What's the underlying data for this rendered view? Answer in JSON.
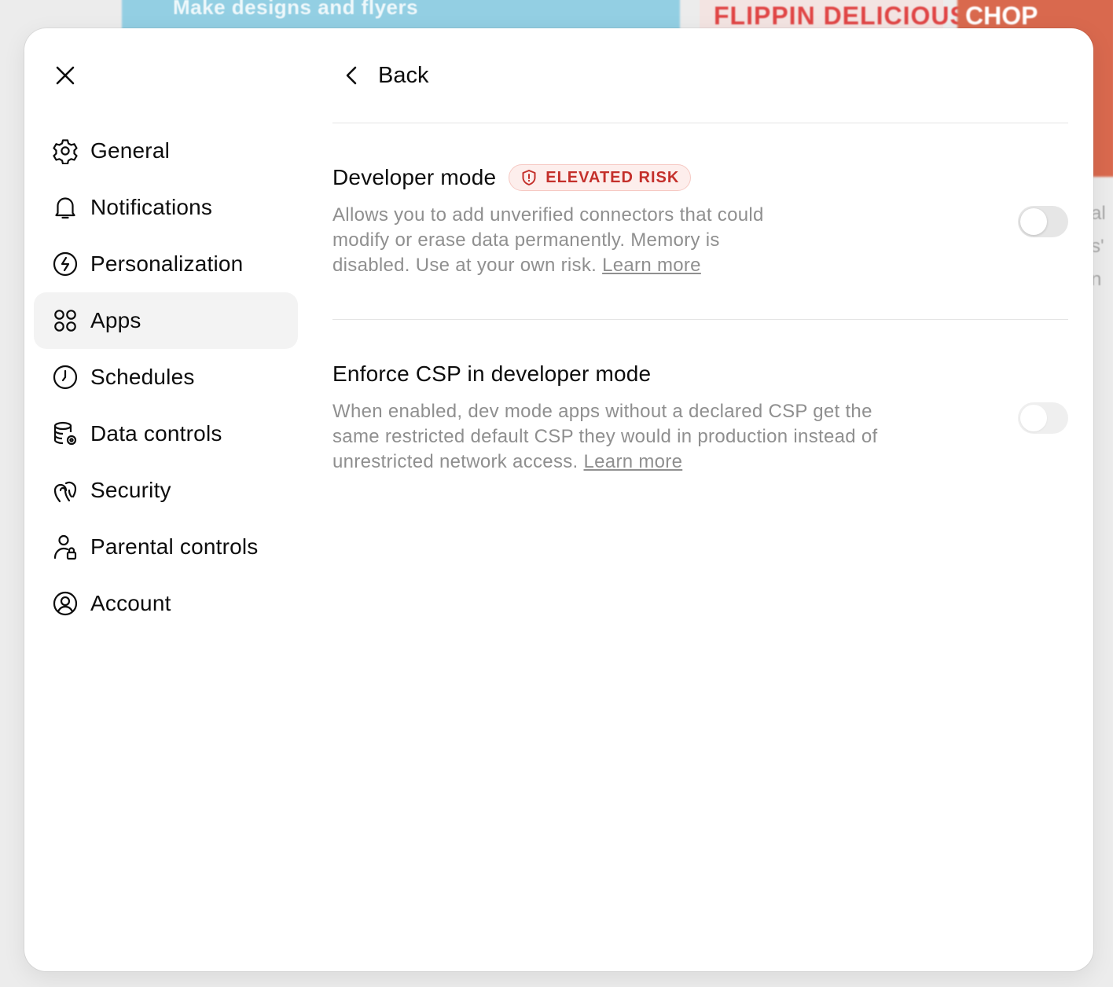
{
  "background": {
    "blue_card_text": "Make designs and flyers",
    "red_card_text": "FLIPPIN DELICIOUS",
    "red_card2_text": "CHOP",
    "side_fragments": [
      "al",
      "s'",
      "n"
    ]
  },
  "modal": {
    "close_icon": "close-icon"
  },
  "sidebar": {
    "items": [
      {
        "label": "General",
        "icon": "gear-icon"
      },
      {
        "label": "Notifications",
        "icon": "bell-icon"
      },
      {
        "label": "Personalization",
        "icon": "personalization-icon"
      },
      {
        "label": "Apps",
        "icon": "apps-grid-icon",
        "active": true
      },
      {
        "label": "Schedules",
        "icon": "clock-icon"
      },
      {
        "label": "Data controls",
        "icon": "database-gear-icon"
      },
      {
        "label": "Security",
        "icon": "security-icon"
      },
      {
        "label": "Parental controls",
        "icon": "person-lock-icon"
      },
      {
        "label": "Account",
        "icon": "account-circle-icon"
      }
    ]
  },
  "main": {
    "back_label": "Back",
    "settings": [
      {
        "title": "Developer mode",
        "badge": "ELEVATED RISK",
        "description": "Allows you to add unverified connectors that could modify or erase data permanently. Memory is disabled. Use at your own risk.",
        "learn_more": "Learn more",
        "enabled": false,
        "toggle_disabled": false
      },
      {
        "title": "Enforce CSP in developer mode",
        "description": "When enabled, dev mode apps without a declared CSP get the same restricted default CSP they would in production instead of unrestricted network access.",
        "learn_more": "Learn more",
        "enabled": false,
        "toggle_disabled": true
      }
    ]
  },
  "colors": {
    "badge_text": "#c4302b",
    "badge_bg": "#fdeeec",
    "active_nav_bg": "#f3f3f3",
    "description_text": "#8f8f8f"
  }
}
